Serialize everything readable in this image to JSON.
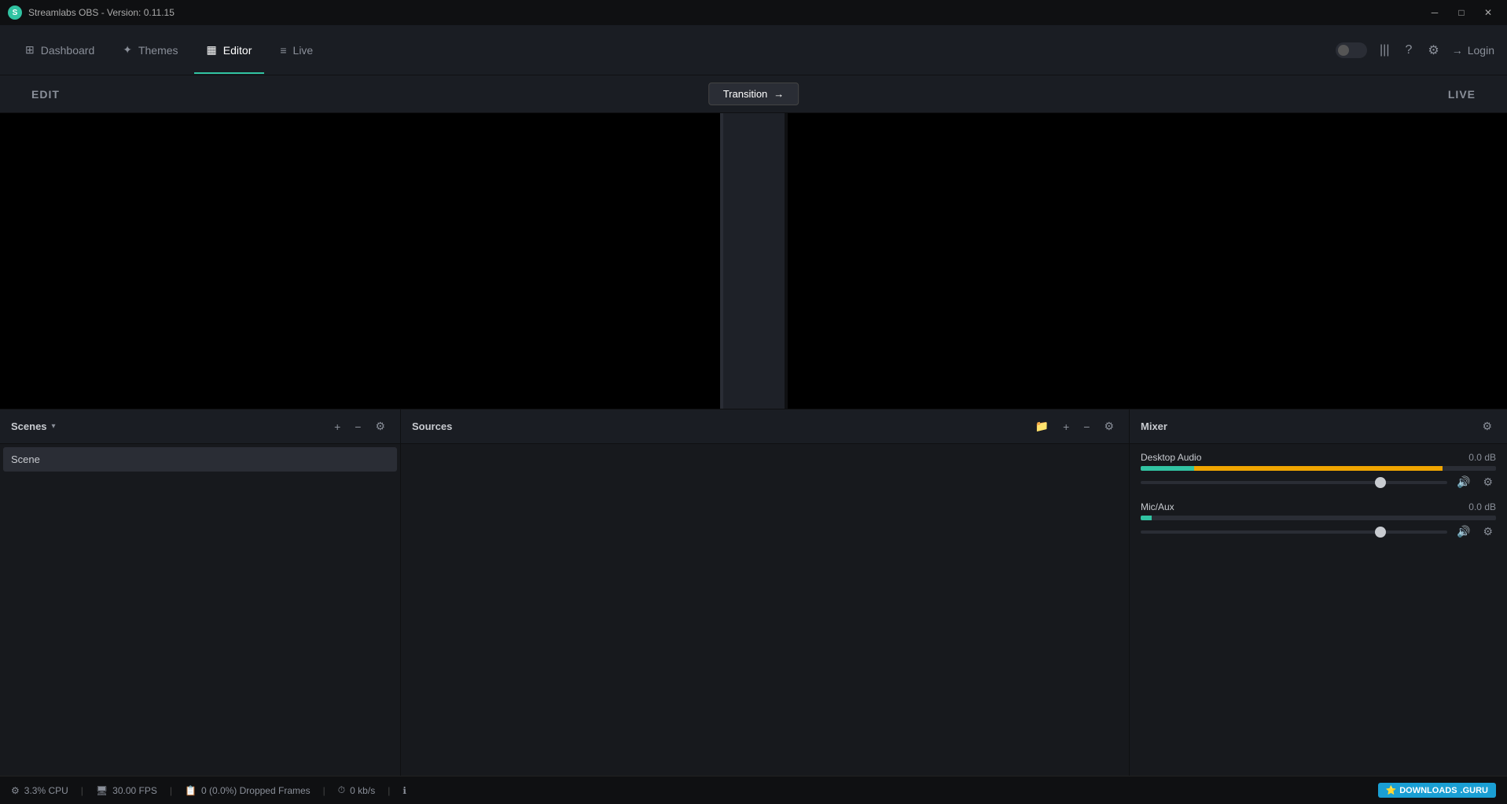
{
  "titlebar": {
    "app_icon": "S",
    "title": "Streamlabs OBS - Version: 0.11.15",
    "controls": {
      "minimize": "─",
      "maximize": "□",
      "close": "✕"
    }
  },
  "navbar": {
    "items": [
      {
        "id": "dashboard",
        "label": "Dashboard",
        "icon": "⊞",
        "active": false
      },
      {
        "id": "themes",
        "label": "Themes",
        "icon": "✦",
        "active": false
      },
      {
        "id": "editor",
        "label": "Editor",
        "icon": "▦",
        "active": true
      },
      {
        "id": "live",
        "label": "Live",
        "icon": "≡",
        "active": false
      }
    ],
    "right": {
      "toggle": "",
      "bars_icon": "|||",
      "help_icon": "?",
      "settings_icon": "⚙",
      "login_icon": "→",
      "login_label": "Login"
    }
  },
  "editor": {
    "edit_label": "EDIT",
    "live_label": "LIVE",
    "transition_label": "Transition",
    "transition_arrow": "→"
  },
  "scenes": {
    "title": "Scenes",
    "dropdown_arrow": "▾",
    "items": [
      {
        "label": "Scene"
      }
    ],
    "controls": {
      "add": "+",
      "remove": "−",
      "settings": "⚙"
    }
  },
  "sources": {
    "title": "Sources",
    "controls": {
      "folder": "📁",
      "add": "+",
      "remove": "−",
      "settings": "⚙"
    }
  },
  "mixer": {
    "title": "Mixer",
    "settings_icon": "⚙",
    "tracks": [
      {
        "name": "Desktop Audio",
        "db": "0.0 dB",
        "level_green_pct": 15,
        "level_yellow_pct": 70,
        "volume_pct": 80
      },
      {
        "name": "Mic/Aux",
        "db": "0.0 dB",
        "level_green_pct": 3,
        "level_yellow_pct": 0,
        "volume_pct": 80
      }
    ],
    "icon_mute": "🔊",
    "icon_settings": "⚙"
  },
  "statusbar": {
    "items": [
      {
        "icon": "⚙",
        "label": "3.3% CPU"
      },
      {
        "icon": "🖥",
        "label": "30.00 FPS"
      },
      {
        "icon": "📋",
        "label": "0 (0.0%) Dropped Frames"
      },
      {
        "icon": "⏱",
        "label": "0 kb/s"
      },
      {
        "icon": "ℹ",
        "label": ""
      }
    ],
    "divider": "|",
    "guru_badge": "DOWNLOADS",
    "guru_icon": "⭐",
    "guru_suffix": ".GURU"
  }
}
